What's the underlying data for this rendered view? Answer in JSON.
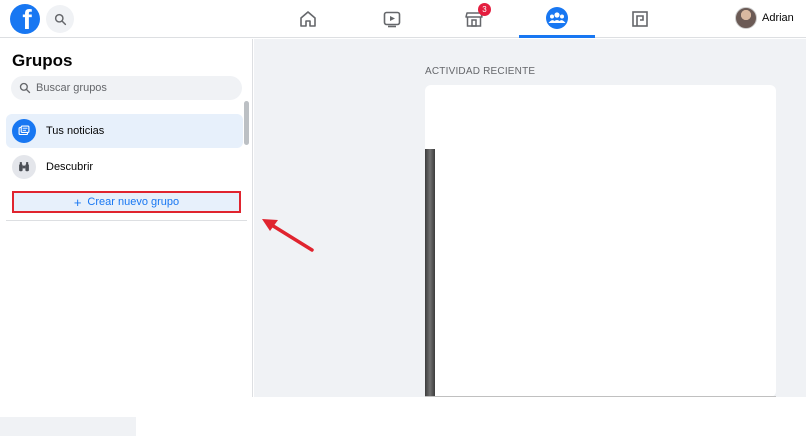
{
  "topbar": {
    "logo_icon": "facebook-logo-icon",
    "search_icon": "search-icon",
    "nav": [
      {
        "name": "home-icon",
        "active": false
      },
      {
        "name": "video-icon",
        "active": false
      },
      {
        "name": "marketplace-icon",
        "active": false,
        "badge": "3"
      },
      {
        "name": "groups-icon",
        "active": true
      },
      {
        "name": "gaming-icon",
        "active": false
      }
    ],
    "profile_name": "Adrian"
  },
  "sidebar": {
    "title": "Grupos",
    "search_placeholder": "Buscar grupos",
    "items": [
      {
        "label": "Tus noticias",
        "icon": "feed-icon",
        "active": true
      },
      {
        "label": "Descubrir",
        "icon": "binoculars-icon",
        "active": false
      }
    ],
    "create_button": {
      "plus": "+",
      "label": "Crear nuevo grupo"
    }
  },
  "main": {
    "section_label": "ACTIVIDAD RECIENTE"
  },
  "colors": {
    "brand": "#1877f2",
    "badge": "#e41e3f",
    "highlight_border": "#e0242f",
    "annotation_arrow": "#e0242f"
  }
}
